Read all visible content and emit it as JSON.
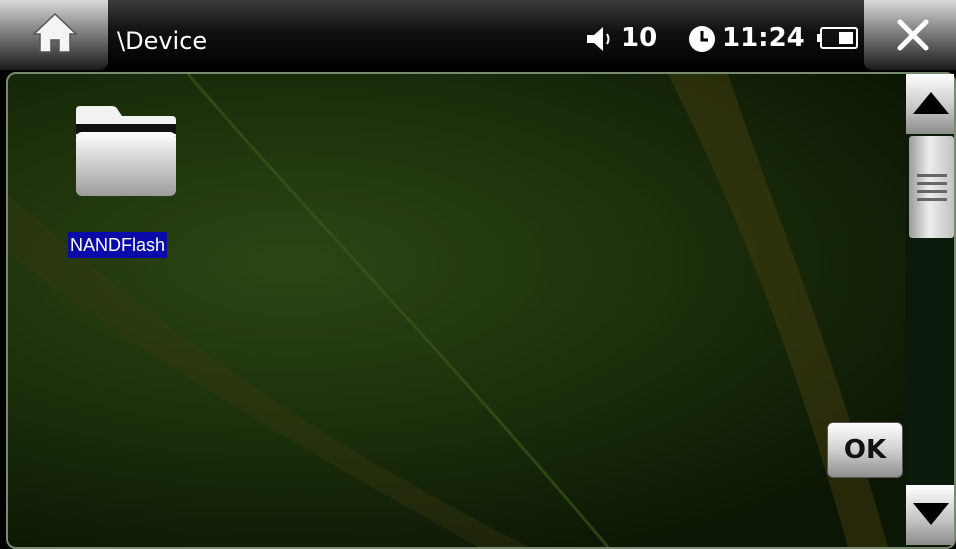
{
  "header": {
    "path": "\\Device",
    "volume": "10",
    "time": "11:24",
    "icons": {
      "home": "home-icon",
      "volume": "speaker-icon",
      "clock": "clock-icon",
      "battery": "battery-icon",
      "close": "close-icon"
    }
  },
  "files": [
    {
      "name": "NANDFlash",
      "icon": "folder-icon",
      "selected": true
    }
  ],
  "actions": {
    "ok_label": "OK"
  },
  "scrollbar": {
    "up_icon": "arrow-up-icon",
    "down_icon": "arrow-down-icon",
    "thumb_icon": "grip-icon"
  },
  "colors": {
    "selection": "#0a0aaa",
    "background": "#1c300b"
  }
}
